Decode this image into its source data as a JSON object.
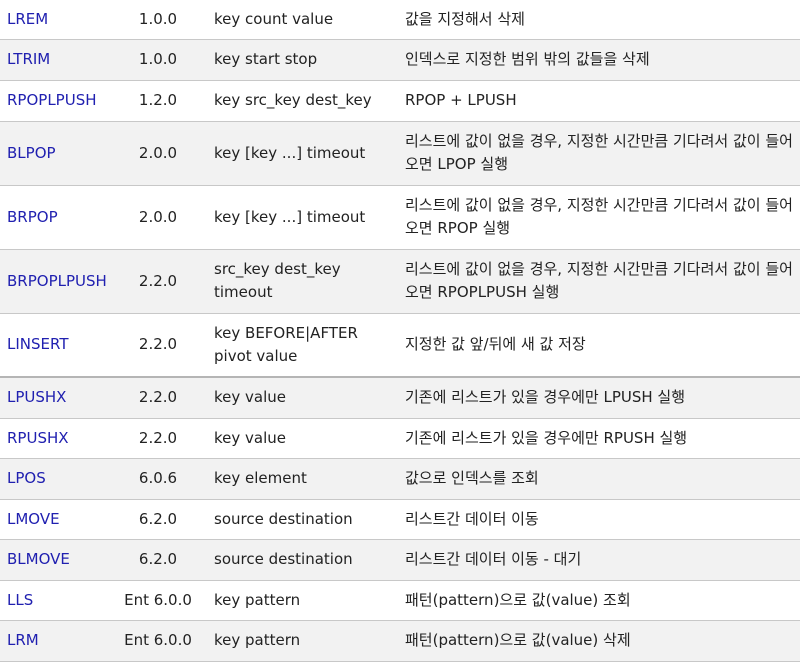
{
  "rows": [
    {
      "command": "LREM",
      "version": "1.0.0",
      "syntax": "key count value",
      "description": "값을 지정해서 삭제"
    },
    {
      "command": "LTRIM",
      "version": "1.0.0",
      "syntax": "key start stop",
      "description": "인덱스로 지정한 범위 밖의 값들을 삭제"
    },
    {
      "command": "RPOPLPUSH",
      "version": "1.2.0",
      "syntax": "key src_key dest_key",
      "description": "RPOP + LPUSH"
    },
    {
      "command": "BLPOP",
      "version": "2.0.0",
      "syntax": "key [key ...] timeout",
      "description": "리스트에 값이 없을 경우, 지정한 시간만큼 기다려서 값이 들어오면 LPOP 실행"
    },
    {
      "command": "BRPOP",
      "version": "2.0.0",
      "syntax": "key [key ...] timeout",
      "description": "리스트에 값이 없을 경우, 지정한 시간만큼 기다려서 값이 들어오면 RPOP 실행"
    },
    {
      "command": "BRPOPLPUSH",
      "version": "2.2.0",
      "syntax": "src_key dest_key timeout",
      "description": "리스트에 값이 없을 경우, 지정한 시간만큼 기다려서 값이 들어오면 RPOPLPUSH 실행"
    },
    {
      "command": "LINSERT",
      "version": "2.2.0",
      "syntax": "key BEFORE|AFTER pivot value",
      "description": "지정한 값 앞/뒤에 새 값 저장"
    },
    {
      "command": "LPUSHX",
      "version": "2.2.0",
      "syntax": "key value",
      "description": "기존에 리스트가 있을 경우에만 LPUSH 실행"
    },
    {
      "command": "RPUSHX",
      "version": "2.2.0",
      "syntax": "key value",
      "description": "기존에 리스트가 있을 경우에만 RPUSH 실행"
    },
    {
      "command": "LPOS",
      "version": "6.0.6",
      "syntax": "key element",
      "description": "값으로 인덱스를 조회"
    },
    {
      "command": "LMOVE",
      "version": "6.2.0",
      "syntax": "source destination",
      "description": "리스트간 데이터 이동"
    },
    {
      "command": "BLMOVE",
      "version": "6.2.0",
      "syntax": "source destination",
      "description": "리스트간 데이터 이동 - 대기"
    },
    {
      "command": "LLS",
      "version": "Ent 6.0.0",
      "syntax": "key pattern",
      "description": "패턴(pattern)으로 값(value) 조회"
    },
    {
      "command": "LRM",
      "version": "Ent 6.0.0",
      "syntax": "key pattern",
      "description": "패턴(pattern)으로 값(value) 삭제"
    }
  ],
  "colors": {
    "link": "#2020b0",
    "row_alt_background": "#f2f2f2",
    "row_background": "#ffffff",
    "border": "#c8c8c8"
  }
}
